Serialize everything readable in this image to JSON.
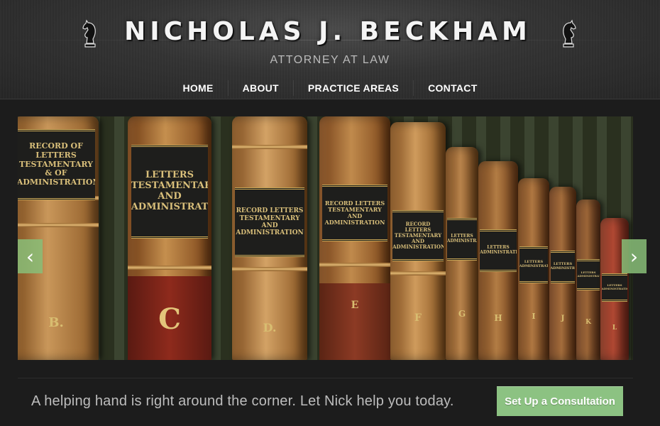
{
  "header": {
    "title": "NICHOLAS J. BECKHAM",
    "subtitle": "ATTORNEY AT LAW",
    "logo_icon": "chess-knight-icon"
  },
  "nav": {
    "items": [
      {
        "label": "HOME"
      },
      {
        "label": "ABOUT"
      },
      {
        "label": "PRACTICE AREAS"
      },
      {
        "label": "CONTACT"
      }
    ]
  },
  "slider": {
    "image": "antique law books on shelf",
    "book_spines": [
      {
        "band": "RECORD OF LETTERS TESTAMENTARY & OF ADMINISTRATION",
        "letter": "B."
      },
      {
        "band": "LETTERS TESTAMENTARY AND ADMINISTRATION",
        "letter": "C"
      },
      {
        "band": "RECORD LETTERS TESTAMENTARY AND ADMINISTRATION",
        "letter": "D."
      },
      {
        "band": "RECORD LETTERS TESTAMENTARY AND ADMINISTRATION",
        "letter": "E"
      },
      {
        "band": "RECORD LETTERS TESTAMENTARY AND ADMINISTRATION",
        "letter": "F"
      },
      {
        "band": "LETTERS ADMINISTRATION",
        "letter": "G"
      },
      {
        "band": "LETTERS ADMINISTRATION",
        "letter": "H"
      },
      {
        "band": "LETTERS ADMINISTRATION",
        "letter": "I"
      },
      {
        "band": "LETTERS ADMINISTRATION",
        "letter": "J"
      },
      {
        "band": "LETTERS ADMINISTRATION",
        "letter": "K"
      },
      {
        "band": "LETTERS ADMINISTRATION",
        "letter": "L"
      }
    ],
    "prev_icon": "chevron-left-icon",
    "next_icon": "chevron-right-icon",
    "prev_glyph": "‹",
    "next_glyph": "›",
    "accent": "#8cc282"
  },
  "cta": {
    "text": "A helping hand is right around the corner.  Let Nick help you today.",
    "button_label": "Set Up a Consultation",
    "button_color": "#8cc282"
  }
}
